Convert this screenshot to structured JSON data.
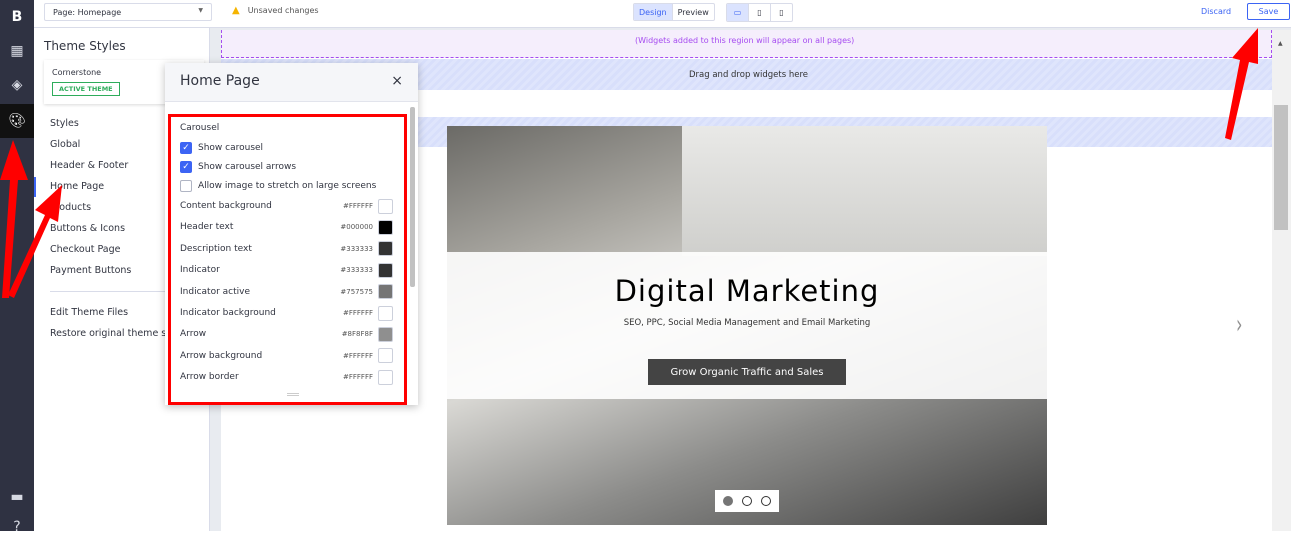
{
  "topbar": {
    "page_select": "Page: Homepage",
    "unsaved": "Unsaved changes",
    "design": "Design",
    "preview": "Preview",
    "discard": "Discard",
    "save": "Save"
  },
  "sidebar": {
    "title": "Theme Styles",
    "theme_name": "Cornerstone",
    "theme_badge": "ACTIVE THEME",
    "items": [
      "Styles",
      "Global",
      "Header & Footer",
      "Home Page",
      "Products",
      "Buttons & Icons",
      "Checkout Page",
      "Payment Buttons"
    ],
    "edit_files": "Edit Theme Files",
    "restore": "Restore original theme styles"
  },
  "popup": {
    "title": "Home Page",
    "close": "×",
    "section": "Carousel",
    "checkboxes": [
      {
        "label": "Show carousel",
        "checked": true
      },
      {
        "label": "Show carousel arrows",
        "checked": true
      },
      {
        "label": "Allow image to stretch on large screens",
        "checked": false
      }
    ],
    "colors": [
      {
        "label": "Content background",
        "hex": "#FFFFFF"
      },
      {
        "label": "Header text",
        "hex": "#000000"
      },
      {
        "label": "Description text",
        "hex": "#333333"
      },
      {
        "label": "Indicator",
        "hex": "#333333"
      },
      {
        "label": "Indicator active",
        "hex": "#757575"
      },
      {
        "label": "Indicator background",
        "hex": "#FFFFFF"
      },
      {
        "label": "Arrow",
        "hex": "#8F8F8F"
      },
      {
        "label": "Arrow background",
        "hex": "#FFFFFF"
      },
      {
        "label": "Arrow border",
        "hex": "#FFFFFF"
      }
    ]
  },
  "canvas": {
    "global_region": "(Widgets added to this region will appear on all pages)",
    "dropzone": "Drag and drop widgets here",
    "carousel": {
      "title": "Digital Marketing",
      "subtitle": "SEO, PPC, Social Media Management and Email Marketing",
      "button": "Grow Organic Traffic and Sales"
    }
  },
  "colors": {
    "accent": "#3c64f4",
    "annotation": "#ff0000",
    "rail": "#2f3242"
  }
}
